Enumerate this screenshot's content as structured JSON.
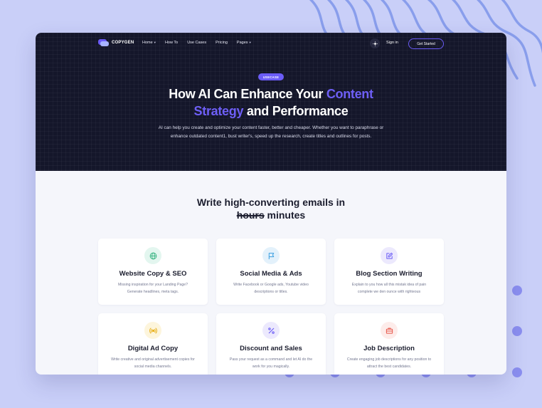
{
  "nav": {
    "logo_text": "COPYGEN",
    "items": [
      {
        "label": "Home",
        "has_dropdown": true
      },
      {
        "label": "How To",
        "has_dropdown": false
      },
      {
        "label": "Use Cases",
        "has_dropdown": false
      },
      {
        "label": "Pricing",
        "has_dropdown": false
      },
      {
        "label": "Pages",
        "has_dropdown": true
      }
    ],
    "sign_in": "Sign in",
    "cta": "Get Started",
    "theme_icon": "sun-icon"
  },
  "hero": {
    "badge": "USECASE",
    "title_line1_plain": "How AI Can Enhance Your ",
    "title_line1_accent": "Content",
    "title_line2_accent": "Strategy",
    "title_line2_plain": " and Performance",
    "description": "AI can help you create and optimize your content faster, better and cheaper. Whether you want to paraphrase or enhance outdated content1, bust writer's, speed up the research, create titles and outlines for posts."
  },
  "section": {
    "title_line1": "Write high-converting emails in",
    "title_struck": "hours",
    "title_rest": " minutes"
  },
  "cards": [
    {
      "icon": "globe-icon",
      "title": "Website Copy & SEO",
      "description": "Missing inspiration for your Landing Page? Generate headlines, meta tags.",
      "icon_bg": "#e3f6ef",
      "icon_color": "#33b27f"
    },
    {
      "icon": "flag-icon",
      "title": "Social Media & Ads",
      "description": "Write Facebook or Google ads, Youtube video descriptions or titles.",
      "icon_bg": "#e3f1fb",
      "icon_color": "#3a9fe0"
    },
    {
      "icon": "edit-icon",
      "title": "Blog Section Writing",
      "description": "Explain to you how all this mistak idea of pain complete we den ounce with righteous",
      "icon_bg": "#ece9fd",
      "icon_color": "#6b5cf6"
    },
    {
      "icon": "broadcast-icon",
      "title": "Digital Ad Copy",
      "description": "Write creative and original advertisement copies for social media channels.",
      "icon_bg": "#fdf5dc",
      "icon_color": "#e9b11d"
    },
    {
      "icon": "percent-icon",
      "title": "Discount and Sales",
      "description": "Pass your request as a command and let AI do the work for you magically.",
      "icon_bg": "#ece9fd",
      "icon_color": "#6b5cf6"
    },
    {
      "icon": "briefcase-icon",
      "title": "Job Description",
      "description": "Create engaging job descriptions for any position to attract the best candidates.",
      "icon_bg": "#fdecea",
      "icon_color": "#e7574b"
    }
  ],
  "colors": {
    "background": "#c9cff8",
    "hero_bg": "#14162a",
    "accent": "#6b5cf6"
  }
}
